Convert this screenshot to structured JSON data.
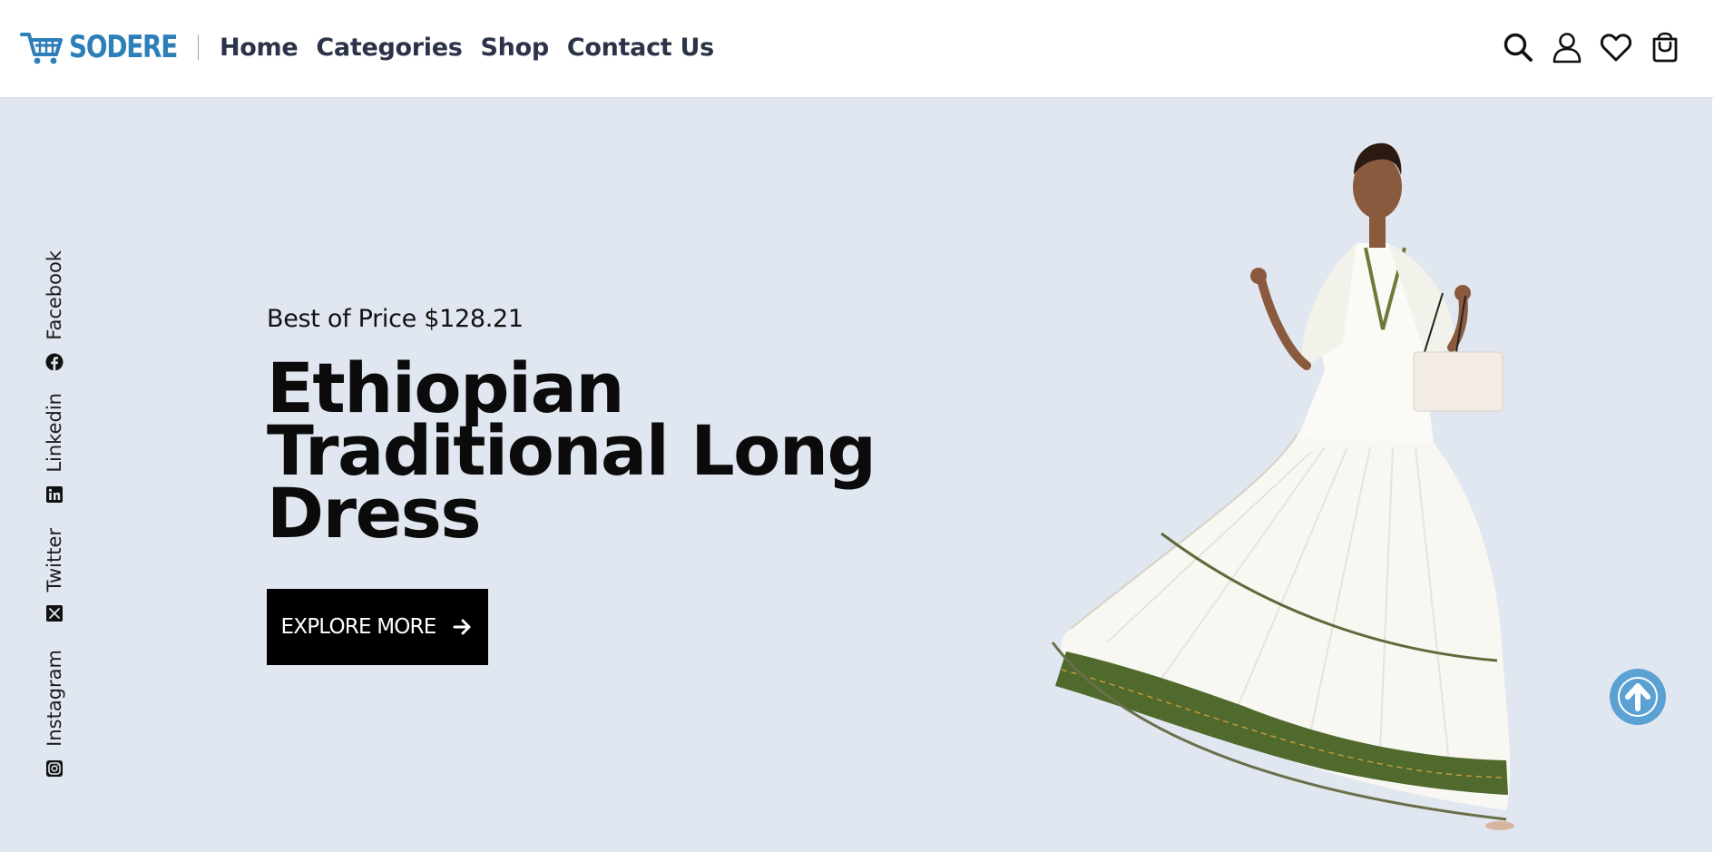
{
  "header": {
    "logo_text": "SODERE",
    "nav": [
      {
        "label": "Home"
      },
      {
        "label": "Categories"
      },
      {
        "label": "Shop"
      },
      {
        "label": "Contact Us"
      }
    ],
    "icons": [
      "search-icon",
      "user-icon",
      "heart-icon",
      "shopping-bag-icon"
    ]
  },
  "social": [
    {
      "label": "Facebook",
      "icon": "facebook-icon"
    },
    {
      "label": "Linkedin",
      "icon": "linkedin-icon"
    },
    {
      "label": "Twitter",
      "icon": "x-twitter-icon"
    },
    {
      "label": "Instagram",
      "icon": "instagram-icon"
    }
  ],
  "hero": {
    "price_line": "Best of Price $128.21",
    "title_lines": [
      "Ethiopian",
      "Traditional Long",
      "Dress"
    ],
    "cta_label": "EXPLORE MORE"
  },
  "colors": {
    "brand": "#2d7fba",
    "hero_bg": "#e1e7f0",
    "nav_text": "#2b3348",
    "cta_bg": "#000000",
    "scroll_top_bg": "#5ba1d3",
    "dress_band": "#4f6a2c"
  }
}
